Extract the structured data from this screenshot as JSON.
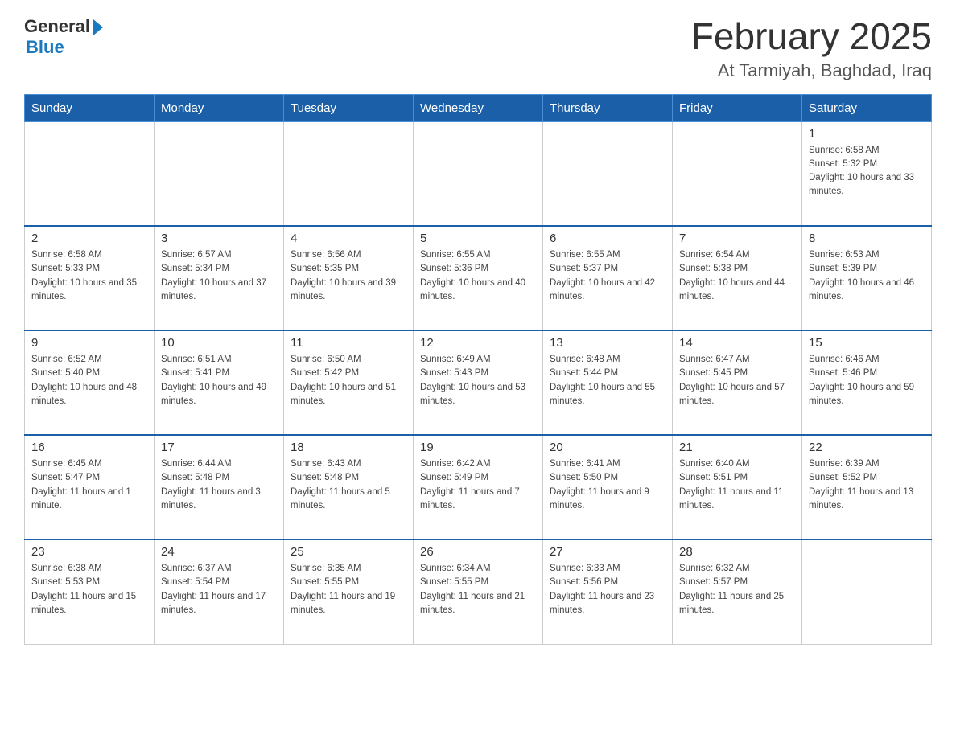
{
  "header": {
    "logo_general": "General",
    "logo_blue": "Blue",
    "title": "February 2025",
    "subtitle": "At Tarmiyah, Baghdad, Iraq"
  },
  "days_of_week": [
    "Sunday",
    "Monday",
    "Tuesday",
    "Wednesday",
    "Thursday",
    "Friday",
    "Saturday"
  ],
  "weeks": [
    [
      {
        "day": "",
        "sunrise": "",
        "sunset": "",
        "daylight": ""
      },
      {
        "day": "",
        "sunrise": "",
        "sunset": "",
        "daylight": ""
      },
      {
        "day": "",
        "sunrise": "",
        "sunset": "",
        "daylight": ""
      },
      {
        "day": "",
        "sunrise": "",
        "sunset": "",
        "daylight": ""
      },
      {
        "day": "",
        "sunrise": "",
        "sunset": "",
        "daylight": ""
      },
      {
        "day": "",
        "sunrise": "",
        "sunset": "",
        "daylight": ""
      },
      {
        "day": "1",
        "sunrise": "Sunrise: 6:58 AM",
        "sunset": "Sunset: 5:32 PM",
        "daylight": "Daylight: 10 hours and 33 minutes."
      }
    ],
    [
      {
        "day": "2",
        "sunrise": "Sunrise: 6:58 AM",
        "sunset": "Sunset: 5:33 PM",
        "daylight": "Daylight: 10 hours and 35 minutes."
      },
      {
        "day": "3",
        "sunrise": "Sunrise: 6:57 AM",
        "sunset": "Sunset: 5:34 PM",
        "daylight": "Daylight: 10 hours and 37 minutes."
      },
      {
        "day": "4",
        "sunrise": "Sunrise: 6:56 AM",
        "sunset": "Sunset: 5:35 PM",
        "daylight": "Daylight: 10 hours and 39 minutes."
      },
      {
        "day": "5",
        "sunrise": "Sunrise: 6:55 AM",
        "sunset": "Sunset: 5:36 PM",
        "daylight": "Daylight: 10 hours and 40 minutes."
      },
      {
        "day": "6",
        "sunrise": "Sunrise: 6:55 AM",
        "sunset": "Sunset: 5:37 PM",
        "daylight": "Daylight: 10 hours and 42 minutes."
      },
      {
        "day": "7",
        "sunrise": "Sunrise: 6:54 AM",
        "sunset": "Sunset: 5:38 PM",
        "daylight": "Daylight: 10 hours and 44 minutes."
      },
      {
        "day": "8",
        "sunrise": "Sunrise: 6:53 AM",
        "sunset": "Sunset: 5:39 PM",
        "daylight": "Daylight: 10 hours and 46 minutes."
      }
    ],
    [
      {
        "day": "9",
        "sunrise": "Sunrise: 6:52 AM",
        "sunset": "Sunset: 5:40 PM",
        "daylight": "Daylight: 10 hours and 48 minutes."
      },
      {
        "day": "10",
        "sunrise": "Sunrise: 6:51 AM",
        "sunset": "Sunset: 5:41 PM",
        "daylight": "Daylight: 10 hours and 49 minutes."
      },
      {
        "day": "11",
        "sunrise": "Sunrise: 6:50 AM",
        "sunset": "Sunset: 5:42 PM",
        "daylight": "Daylight: 10 hours and 51 minutes."
      },
      {
        "day": "12",
        "sunrise": "Sunrise: 6:49 AM",
        "sunset": "Sunset: 5:43 PM",
        "daylight": "Daylight: 10 hours and 53 minutes."
      },
      {
        "day": "13",
        "sunrise": "Sunrise: 6:48 AM",
        "sunset": "Sunset: 5:44 PM",
        "daylight": "Daylight: 10 hours and 55 minutes."
      },
      {
        "day": "14",
        "sunrise": "Sunrise: 6:47 AM",
        "sunset": "Sunset: 5:45 PM",
        "daylight": "Daylight: 10 hours and 57 minutes."
      },
      {
        "day": "15",
        "sunrise": "Sunrise: 6:46 AM",
        "sunset": "Sunset: 5:46 PM",
        "daylight": "Daylight: 10 hours and 59 minutes."
      }
    ],
    [
      {
        "day": "16",
        "sunrise": "Sunrise: 6:45 AM",
        "sunset": "Sunset: 5:47 PM",
        "daylight": "Daylight: 11 hours and 1 minute."
      },
      {
        "day": "17",
        "sunrise": "Sunrise: 6:44 AM",
        "sunset": "Sunset: 5:48 PM",
        "daylight": "Daylight: 11 hours and 3 minutes."
      },
      {
        "day": "18",
        "sunrise": "Sunrise: 6:43 AM",
        "sunset": "Sunset: 5:48 PM",
        "daylight": "Daylight: 11 hours and 5 minutes."
      },
      {
        "day": "19",
        "sunrise": "Sunrise: 6:42 AM",
        "sunset": "Sunset: 5:49 PM",
        "daylight": "Daylight: 11 hours and 7 minutes."
      },
      {
        "day": "20",
        "sunrise": "Sunrise: 6:41 AM",
        "sunset": "Sunset: 5:50 PM",
        "daylight": "Daylight: 11 hours and 9 minutes."
      },
      {
        "day": "21",
        "sunrise": "Sunrise: 6:40 AM",
        "sunset": "Sunset: 5:51 PM",
        "daylight": "Daylight: 11 hours and 11 minutes."
      },
      {
        "day": "22",
        "sunrise": "Sunrise: 6:39 AM",
        "sunset": "Sunset: 5:52 PM",
        "daylight": "Daylight: 11 hours and 13 minutes."
      }
    ],
    [
      {
        "day": "23",
        "sunrise": "Sunrise: 6:38 AM",
        "sunset": "Sunset: 5:53 PM",
        "daylight": "Daylight: 11 hours and 15 minutes."
      },
      {
        "day": "24",
        "sunrise": "Sunrise: 6:37 AM",
        "sunset": "Sunset: 5:54 PM",
        "daylight": "Daylight: 11 hours and 17 minutes."
      },
      {
        "day": "25",
        "sunrise": "Sunrise: 6:35 AM",
        "sunset": "Sunset: 5:55 PM",
        "daylight": "Daylight: 11 hours and 19 minutes."
      },
      {
        "day": "26",
        "sunrise": "Sunrise: 6:34 AM",
        "sunset": "Sunset: 5:55 PM",
        "daylight": "Daylight: 11 hours and 21 minutes."
      },
      {
        "day": "27",
        "sunrise": "Sunrise: 6:33 AM",
        "sunset": "Sunset: 5:56 PM",
        "daylight": "Daylight: 11 hours and 23 minutes."
      },
      {
        "day": "28",
        "sunrise": "Sunrise: 6:32 AM",
        "sunset": "Sunset: 5:57 PM",
        "daylight": "Daylight: 11 hours and 25 minutes."
      },
      {
        "day": "",
        "sunrise": "",
        "sunset": "",
        "daylight": ""
      }
    ]
  ]
}
